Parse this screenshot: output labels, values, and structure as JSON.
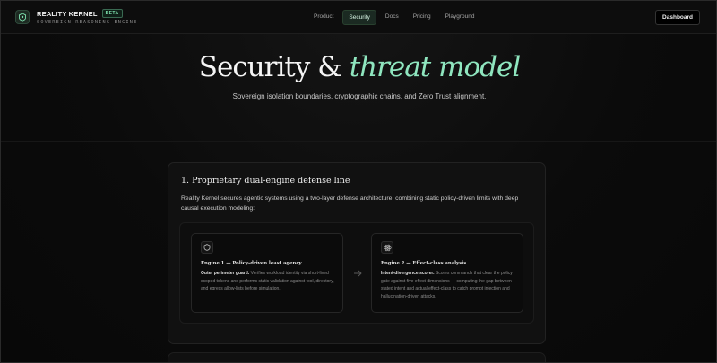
{
  "app": {
    "title": "REALITY KERNEL",
    "badge": "BETA",
    "subtitle": "SOVEREIGN REASONING ENGINE"
  },
  "nav": {
    "items": [
      {
        "label": "Product"
      },
      {
        "label": "Security"
      },
      {
        "label": "Docs"
      },
      {
        "label": "Pricing"
      },
      {
        "label": "Playground"
      }
    ],
    "active": "Security",
    "dashboard_label": "Dashboard"
  },
  "hero": {
    "title_main": "Security & ",
    "title_accent": "threat model",
    "subtitle": "Sovereign isolation boundaries, cryptographic chains, and Zero Trust alignment."
  },
  "section1": {
    "heading": "1. Proprietary dual-engine defense line",
    "intro": "Reality Kernel secures agentic systems using a two-layer defense architecture, combining static policy-driven limits with deep causal execution modeling:",
    "engines": [
      {
        "icon": "shield-icon",
        "title": "Engine 1 — Policy-driven least agency",
        "lead": "Outer perimeter guard.",
        "body": " Verifies workload identity via short-lived scoped tokens and performs static validation against tool, directory, and egress allow-lists before simulation."
      },
      {
        "icon": "atom-icon",
        "title": "Engine 2 — Effect-class analysis",
        "lead": "Intent-divergence scorer.",
        "body": " Scores commands that clear the policy gate against five effect dimensions — computing the gap between stated intent and actual effect-class to catch prompt injection and hallucination-driven attacks."
      }
    ]
  },
  "colors": {
    "accent": "#8fe6bf",
    "background": "#0b0b0b",
    "nav_active_bg": "#1b2a22"
  }
}
